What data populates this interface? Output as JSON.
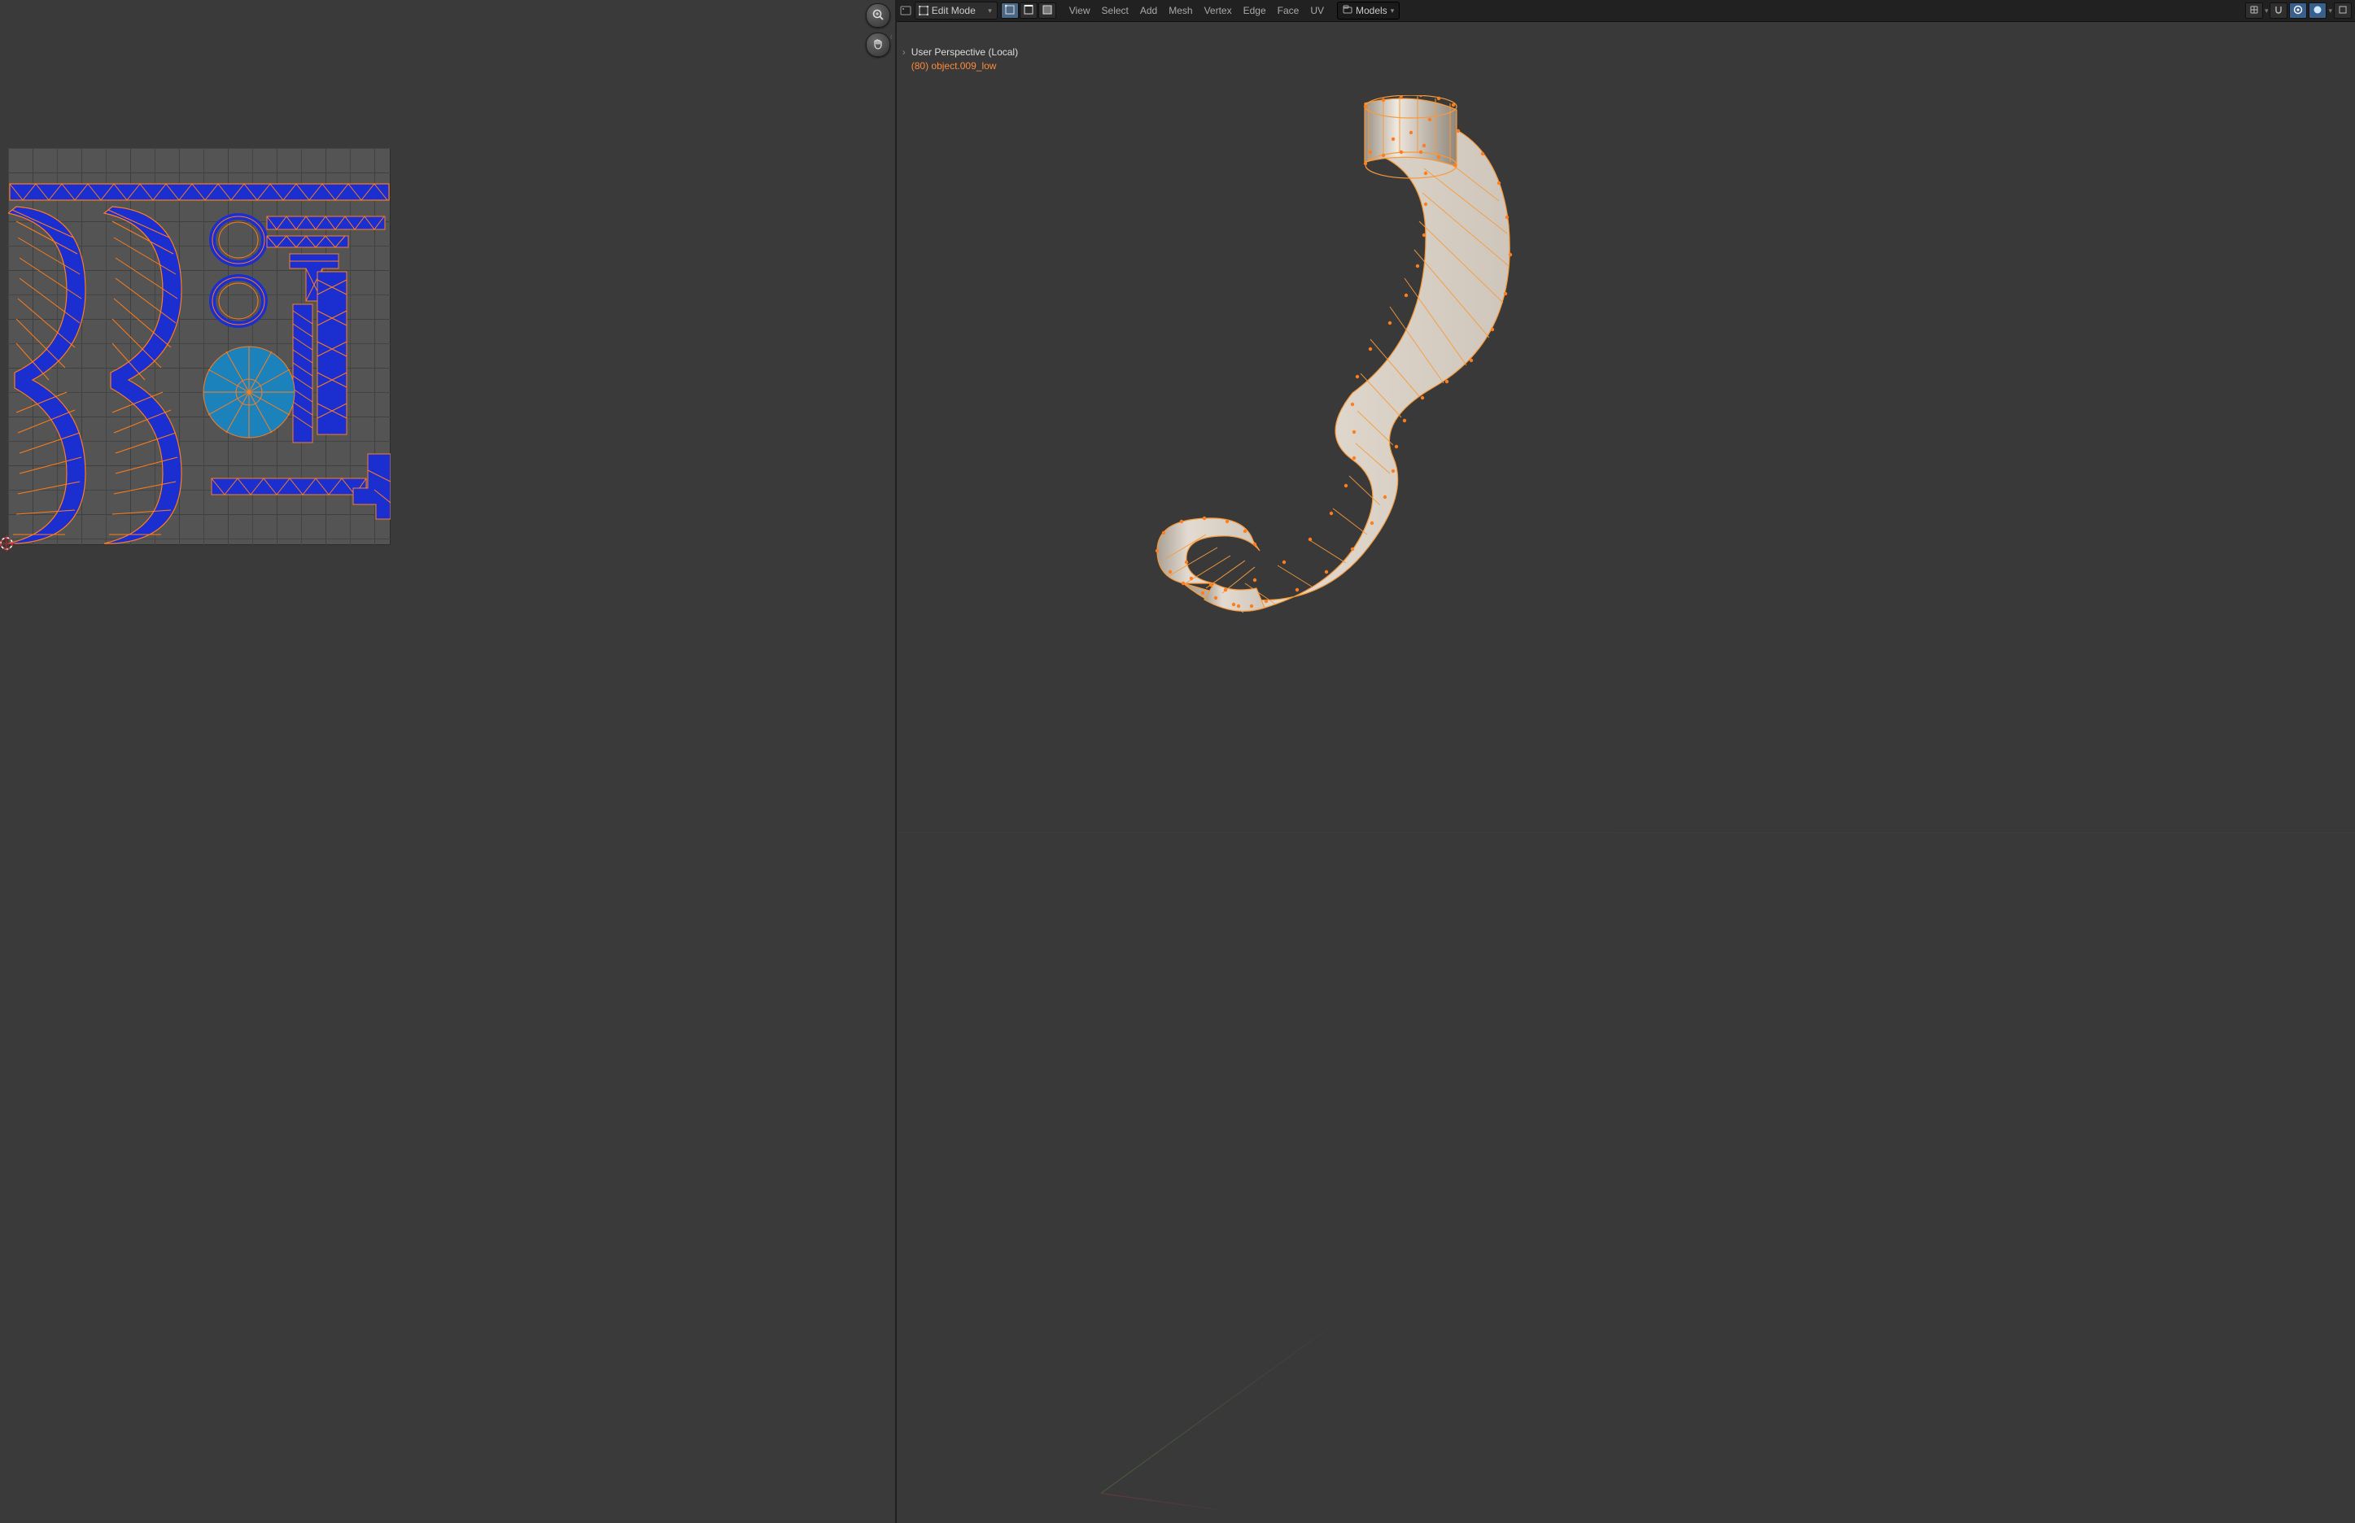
{
  "header": {
    "mode_label": "Edit Mode",
    "menus": [
      "View",
      "Select",
      "Add",
      "Mesh",
      "Vertex",
      "Edge",
      "Face",
      "UV"
    ],
    "collection_label": "Models",
    "select_mode": [
      "vertex",
      "edge",
      "face"
    ],
    "active_select_mode": 0
  },
  "overlay": {
    "crumb": "User Perspective (Local)",
    "object": "(80) object.009_low"
  },
  "uv": {
    "zoom_icon": "zoom-icon",
    "pan_icon": "pan-icon"
  },
  "colors": {
    "uv_face": "#1b2fd1",
    "uv_face_light": "#1c82bc",
    "uv_edge": "#ff7d1a",
    "vert": "#ff7d1a",
    "mesh_face": "#d8cec1",
    "mesh_face_dark": "#9c9186",
    "mesh_edge": "#f79a3a"
  }
}
